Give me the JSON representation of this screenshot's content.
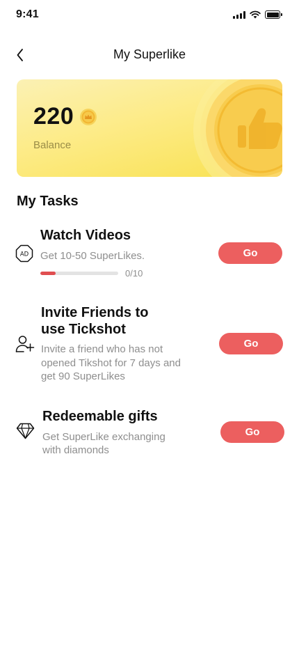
{
  "status_bar": {
    "time": "9:41",
    "icons": [
      "cellular-signal-icon",
      "wifi-icon",
      "battery-icon"
    ]
  },
  "header": {
    "title": "My Superlike",
    "back_icon": "chevron-left-icon"
  },
  "balance": {
    "amount": "220",
    "label": "Balance",
    "coin_icon": "crown-coin-icon",
    "decor_icon": "thumbs-up-coin-icon"
  },
  "tasks_section": {
    "title": "My Tasks",
    "tasks": [
      {
        "icon": "ad-icon",
        "title": "Watch Videos",
        "description": "Get 10-50 SuperLikes.",
        "progress_text": "0/10",
        "progress_fraction": 0.2,
        "button_label": "Go"
      },
      {
        "icon": "add-user-icon",
        "title_line1": "Invite Friends to",
        "title_line2": "use Tickshot",
        "desc_line1": "Invite a friend who has not",
        "desc_line2": "opened Tikshot for 7 days and",
        "desc_line3": "get 90 SuperLikes",
        "button_label": "Go"
      },
      {
        "icon": "diamond-icon",
        "title": "Redeemable gifts",
        "desc_line1": "Get SuperLike exchanging",
        "desc_line2": "with diamonds",
        "button_label": "Go"
      }
    ]
  },
  "colors": {
    "accent": "#ec5f5f",
    "progress": "#e04e50",
    "card_gradient_start": "#fbf1b4",
    "card_gradient_end": "#f8e150",
    "muted_text": "#8e8e8e"
  }
}
